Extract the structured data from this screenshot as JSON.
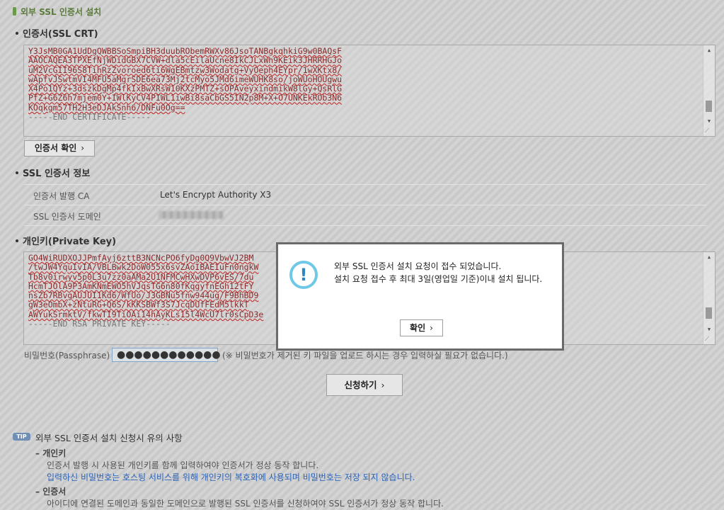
{
  "page_title": "외부 SSL 인증서 설치",
  "certificate": {
    "label": "인증서(SSL CRT)",
    "lines": [
      "Y3JsMB0GA1UdDgQWBBSoSmpiBH3duubRObemRWXv86JsoTANBgkqhkiG9w0BAQsF",
      "AAOCAQEA3TPXEfNjWDidGBX7CVW+dla5cEilaUcne8IkCJLxWh9KEik3JHRRHGJo",
      "uM2VcGII96S8TihRzZvoroed6ti6WgEBmtzw3Wodatg+VyOeph4EYpr/1wXKtx8/",
      "wApfvJSwtmVI4MFU5aMgrSDE6ea73Mj2tcMyo5JMd6imeWUHK8so/joWUoHOUgwu",
      "X4Po1QYz+3dszkDgMp4fkIxBwXRsW10KXzPMTZ+sOPAveyxindmikW8lGy+QsRlG",
      "PfZ+G6Z6h7mjem0Y+IWlKyCV4PIWL1iwBi8saCbGS5IN2p8M+X+O7UNKEkROb3N6",
      "KOqkgm57TH2H3eDJAkSnh6/DNFu0Og=="
    ],
    "end_marker": "-----END CERTIFICATE-----",
    "check_button": "인증서 확인"
  },
  "ssl_info": {
    "label": "SSL 인증서 정보",
    "rows": [
      {
        "key": "인증서 발행 CA",
        "value": "Let's Encrypt Authority X3"
      },
      {
        "key": "SSL 인증서 도메인",
        "value": ""
      }
    ]
  },
  "private_key": {
    "label": "개인키(Private Key)",
    "lines": [
      "GO4WiRUDXOJJPmfAyj6zttB3NCNcPO6fyDg0Q9VbwVJ2BM",
      "/twJW4YquIvIA/VBLBwk2DoW055x6svZAoIBAEIuFn0ngkW",
      "Tb8v0irwyv5p0L3u7zz0aAMa2U1NFMCwHXwDVP6vES/7du",
      "HcmTJOlA9P3AmKNmEWO5hVJqsTG6n80fKqgyfnEGh12tFY",
      "nsZb7RBvgAUJUI1Kd6/WfUo/J3GBNu5fnw944ug/F9BhBD9",
      "gW3eOmbX+zNtuRG+Q6S/kKKSBWf3S7JcqDUfFEdM5lkkT",
      "AWYukSrmktV/fkwTI9TiOAi14hAyKLs15l4WcU7lr0sCpD3e"
    ],
    "end_marker": "-----END RSA PRIVATE KEY-----"
  },
  "passphrase": {
    "label": "비밀번호(Passphrase)",
    "value": "●●●●●●●●●●●●",
    "hint": "(※ 비밀번호가 제거된 키 파일을 업로드 하시는 경우 입력하실 필요가 없습니다.)"
  },
  "submit_button": "신청하기",
  "tip": {
    "badge": "TIP",
    "title": "외부 SSL 인증서 설치 신청시 유의 사항",
    "items": [
      {
        "head": "개인키",
        "line1": "인증서 발행 시 사용된 개인키를 함께 입력하여야 인증서가 정상 동작 합니다.",
        "line2": "입력하신 비밀번호는 호스팅 서비스를 위해 개인키의 복호화에 사용되며 비밀번호는 저장 되지 않습니다."
      },
      {
        "head": "인증서",
        "line1": "아이디에 연결된 도메인과 동일한 도메인으로 발행된 SSL 인증서를 신청하여야 SSL 인증서가 정상 동작 합니다."
      }
    ]
  },
  "modal": {
    "line1": "외부 SSL 인증서 설치 요청이 접수 되었습니다.",
    "line2": "설치 요청 접수 후 최대 3일(영업일 기준)이내 설치 됩니다.",
    "ok_button": "확인"
  },
  "colors": {
    "accent_green": "#6a9a4a",
    "link_blue": "#2a62b6",
    "info_icon": "#6fc8e6"
  }
}
